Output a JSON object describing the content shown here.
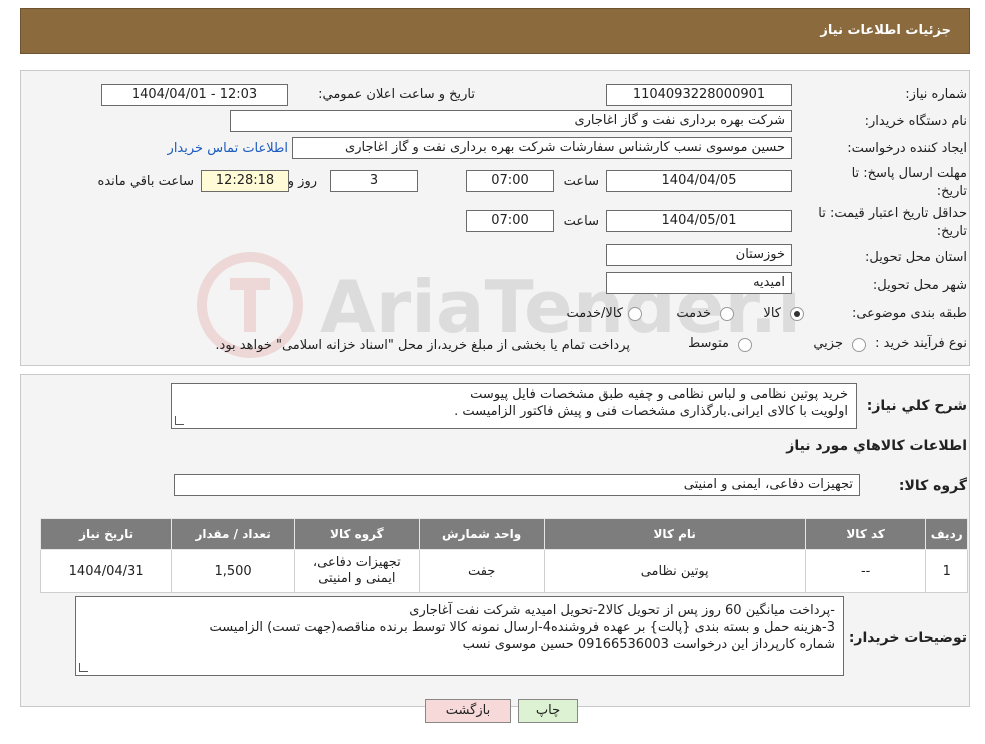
{
  "header": {
    "title": "جزئيات اطلاعات نياز"
  },
  "form": {
    "need_number_label": "شماره نياز:",
    "need_number": "1104093228000901",
    "announce_label": "تاريخ و ساعت اعلان عمومي:",
    "announce_value": "1404/04/01 - 12:03",
    "buyer_org_label": "نام دستگاه خريدار:",
    "buyer_org": "شرکت بهره برداری نفت و گاز اغاجاری",
    "creator_label": "ايجاد کننده درخواست:",
    "creator": "حسین موسوی نسب کارشناس سفارشات شرکت بهره برداری نفت و گاز اغاجاری",
    "contact_link": "اطلاعات تماس خريدار",
    "deadline_label_1": "مهلت ارسال پاسخ: تا",
    "deadline_label_2": "تاريخ:",
    "deadline_date": "1404/04/05",
    "time_label": "ساعت",
    "deadline_time": "07:00",
    "days_value": "3",
    "days_label": "روز و",
    "remaining_time": "12:28:18",
    "remaining_label": "ساعت باقي مانده",
    "validity_label_1": "حداقل تاريخ اعتبار قيمت: تا",
    "validity_label_2": "تاريخ:",
    "validity_date": "1404/05/01",
    "validity_time": "07:00",
    "province_label": "استان محل تحويل:",
    "province": "خوزستان",
    "city_label": "شهر محل تحويل:",
    "city": "امیدیه",
    "category_label": "طبقه بندی موضوعی:",
    "category_options": [
      "کالا",
      "خدمت",
      "کالا/خدمت"
    ],
    "category_selected": "کالا",
    "process_label": "نوع فرآيند خريد :",
    "process_options": [
      "جزيي",
      "متوسط"
    ],
    "process_note": "پرداخت تمام يا بخشی از مبلغ خريد،از محل \"اسناد خزانه اسلامی\" خواهد بود."
  },
  "description": {
    "label": "شرح كلي نياز:",
    "line1": "خرید پوتین نظامی و لباس نظامی و چفیه  طبق مشخصات فایل پیوست",
    "line2": "اولویت با کالای ایرانی.بارگذاری مشخصات فنی و پیش فاکتور الزامیست ."
  },
  "items_section": {
    "title": "اطلاعات كالاهاي مورد نياز",
    "group_label": "گروه کالا:",
    "group_value": "تجهیزات دفاعی، ایمنی و امنیتی",
    "columns": [
      "رديف",
      "کد کالا",
      "نام کالا",
      "واحد شمارش",
      "گروه کالا",
      "تعداد / مقدار",
      "تاريخ نياز"
    ],
    "rows": [
      {
        "index": "1",
        "code": "--",
        "name": "پوتین نظامی",
        "unit": "جفت",
        "group_line1": "تجهیزات دفاعی،",
        "group_line2": "ایمنی و امنیتی",
        "qty": "1,500",
        "date": "1404/04/31"
      }
    ]
  },
  "buyer_notes": {
    "label": "توضيحات خريدار:",
    "line1": "-پرداخت میانگین 60 روز پس از تحویل کالا2-تحویل امیدیه شرکت نفت آغاجاری",
    "line2": "3-هزینه حمل  و بسته بندی {پالت} بر عهده فروشنده4-ارسال نمونه کالا توسط برنده مناقصه(جهت تست) الزامیست",
    "line3": "شماره کارپرداز این درخواست 09166536003 حسین موسوی نسب"
  },
  "buttons": {
    "print": "چاپ",
    "back": "بازگشت"
  },
  "colors": {
    "header": "#8b6a3e",
    "back_button": "#f7d9d9",
    "print_button": "#dcf2d2"
  }
}
